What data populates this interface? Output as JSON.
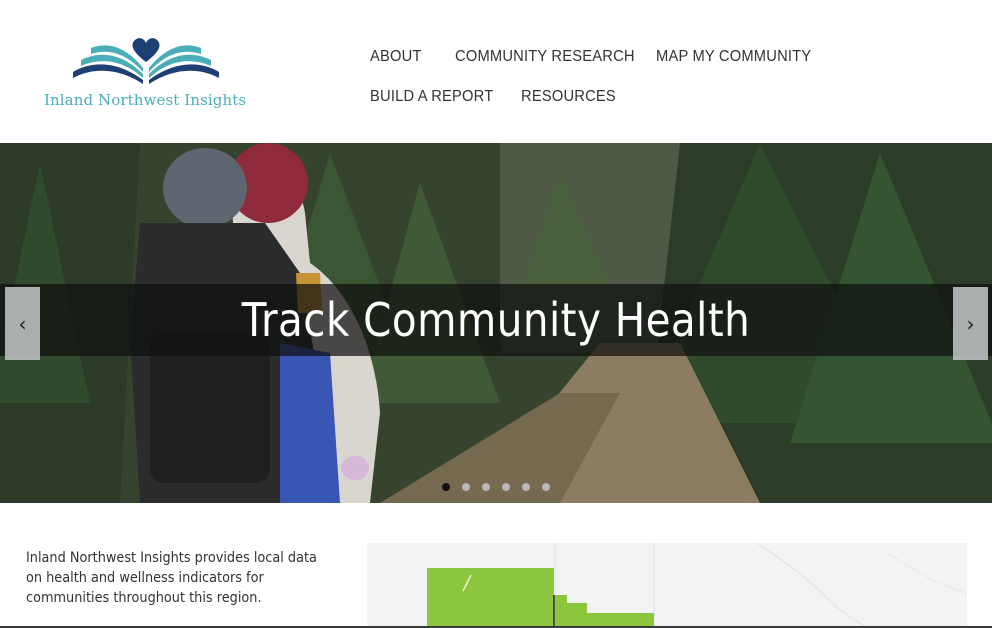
{
  "logo": {
    "text": "Inland Northwest Insights",
    "icon": "heart-book-icon",
    "colors": {
      "teal": "#4aaeb9",
      "navy": "#1e3f73"
    }
  },
  "nav": {
    "items": [
      {
        "label": "ABOUT"
      },
      {
        "label": "COMMUNITY RESEARCH"
      },
      {
        "label": "MAP MY COMMUNITY"
      },
      {
        "label": "BUILD A REPORT"
      },
      {
        "label": "RESOURCES"
      }
    ]
  },
  "hero": {
    "caption": "Track Community Health",
    "prev_icon": "chevron-left-icon",
    "next_icon": "chevron-right-icon",
    "slide_count": 6,
    "active_slide": 1
  },
  "intro": {
    "text": "Inland Northwest Insights provides local data on health and wellness indicators for communities throughout this region."
  },
  "map": {
    "colors": {
      "region": "#8cc63f",
      "background": "#f3f3f3"
    }
  }
}
